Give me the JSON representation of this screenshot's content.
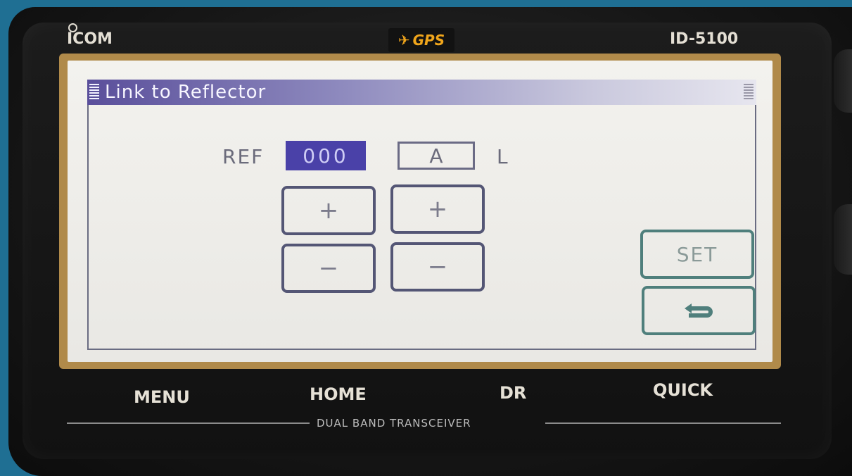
{
  "device": {
    "brand": "ICOM",
    "gps_label": "GPS",
    "model": "ID-5100",
    "caption": "DUAL BAND TRANSCEIVER"
  },
  "screen": {
    "title": "Link to Reflector",
    "ref_label": "REF",
    "ref_value": "000",
    "module_value": "A",
    "suffix_label": "L",
    "plus_label": "+",
    "minus_label": "−",
    "set_label": "SET",
    "back_icon": "return-arrow-icon"
  },
  "hardware_buttons": [
    "MENU",
    "HOME",
    "DR",
    "QUICK"
  ],
  "colors": {
    "title_bar": "#5a4f9b",
    "ref_highlight": "#4a41a8",
    "side_button_border": "#4f7f7c",
    "gps_text": "#f0a51b"
  }
}
